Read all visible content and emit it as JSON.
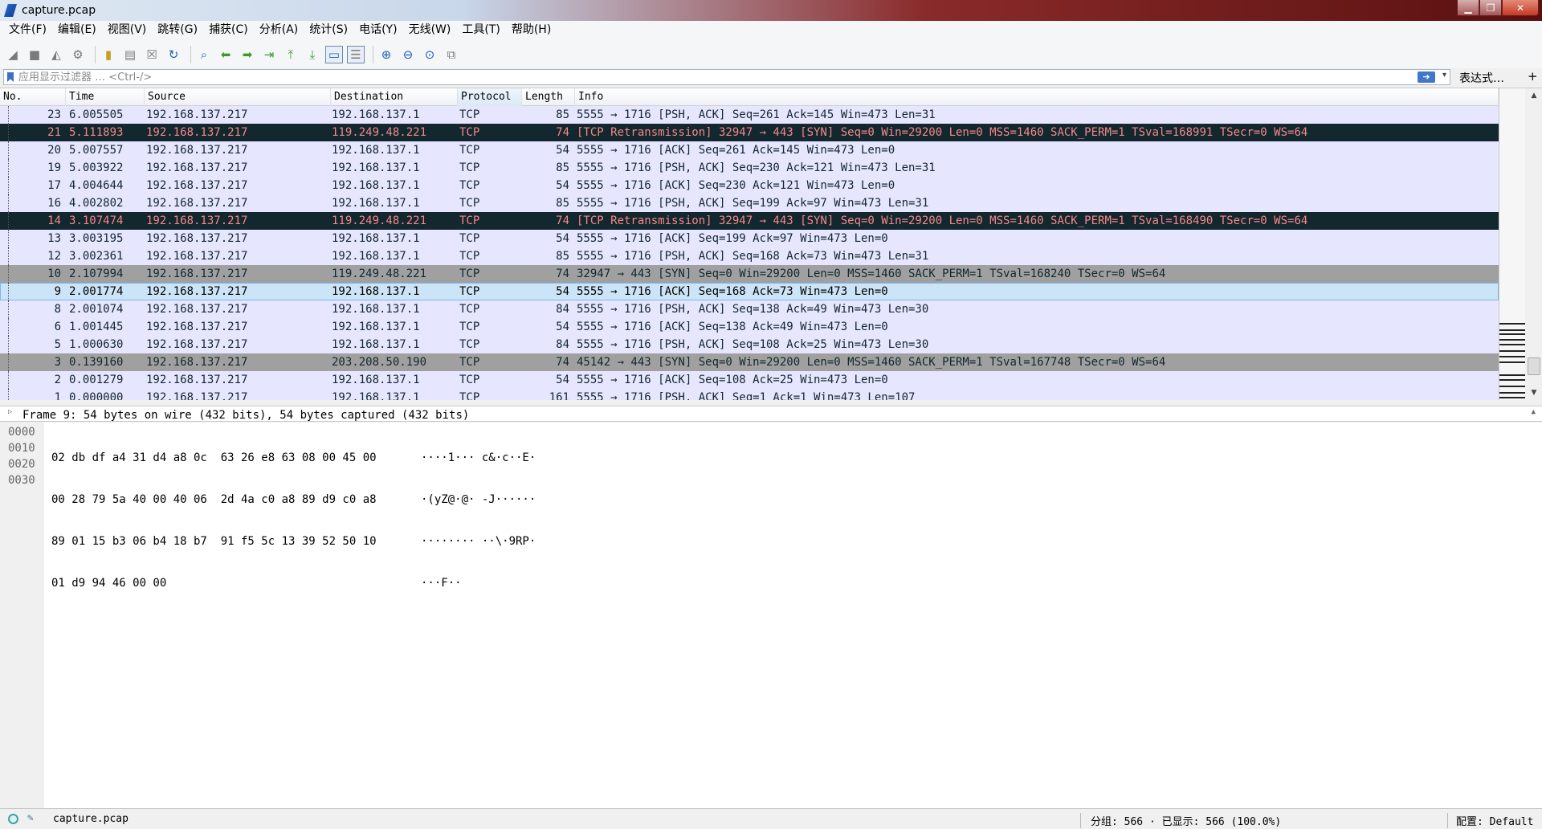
{
  "window": {
    "title": "capture.pcap",
    "minimize": "▁",
    "maximize": "❐",
    "close": "✕"
  },
  "menu": [
    "文件(F)",
    "编辑(E)",
    "视图(V)",
    "跳转(G)",
    "捕获(C)",
    "分析(A)",
    "统计(S)",
    "电话(Y)",
    "无线(W)",
    "工具(T)",
    "帮助(H)"
  ],
  "toolbar": {
    "icons": [
      "shark-fin-start-icon",
      "stop-square-icon",
      "restart-fin-icon",
      "capture-options-gear-icon",
      "open-folder-icon",
      "save-file-icon",
      "close-file-icon",
      "reload-icon",
      "find-magnifier-icon",
      "go-back-arrow-icon",
      "go-forward-arrow-icon",
      "go-to-packet-icon",
      "go-first-icon",
      "go-last-icon",
      "auto-scroll-icon",
      "colorize-icon",
      "zoom-in-icon",
      "zoom-out-icon",
      "zoom-normal-icon",
      "resize-columns-icon"
    ]
  },
  "filter": {
    "placeholder": "应用显示过滤器 … <Ctrl-/>",
    "value": "",
    "expression_label": "表达式…",
    "plus_label": "+"
  },
  "packet_list": {
    "columns": [
      "No.",
      "Time",
      "Source",
      "Destination",
      "Protocol",
      "Length",
      "Info"
    ],
    "rows": [
      {
        "no": "23",
        "time": "6.005505",
        "src": "192.168.137.217",
        "dst": "192.168.137.1",
        "proto": "TCP",
        "len": "85",
        "info": "5555 → 1716 [PSH, ACK] Seq=261 Ack=145 Win=473 Len=31",
        "style": "tcp"
      },
      {
        "no": "21",
        "time": "5.111893",
        "src": "192.168.137.217",
        "dst": "119.249.48.221",
        "proto": "TCP",
        "len": "74",
        "info": "[TCP Retransmission] 32947 → 443 [SYN] Seq=0 Win=29200 Len=0 MSS=1460 SACK_PERM=1 TSval=168991 TSecr=0 WS=64",
        "style": "bad"
      },
      {
        "no": "20",
        "time": "5.007557",
        "src": "192.168.137.217",
        "dst": "192.168.137.1",
        "proto": "TCP",
        "len": "54",
        "info": "5555 → 1716 [ACK] Seq=261 Ack=145 Win=473 Len=0",
        "style": "tcp"
      },
      {
        "no": "19",
        "time": "5.003922",
        "src": "192.168.137.217",
        "dst": "192.168.137.1",
        "proto": "TCP",
        "len": "85",
        "info": "5555 → 1716 [PSH, ACK] Seq=230 Ack=121 Win=473 Len=31",
        "style": "tcp"
      },
      {
        "no": "17",
        "time": "4.004644",
        "src": "192.168.137.217",
        "dst": "192.168.137.1",
        "proto": "TCP",
        "len": "54",
        "info": "5555 → 1716 [ACK] Seq=230 Ack=121 Win=473 Len=0",
        "style": "tcp"
      },
      {
        "no": "16",
        "time": "4.002802",
        "src": "192.168.137.217",
        "dst": "192.168.137.1",
        "proto": "TCP",
        "len": "85",
        "info": "5555 → 1716 [PSH, ACK] Seq=199 Ack=97 Win=473 Len=31",
        "style": "tcp"
      },
      {
        "no": "14",
        "time": "3.107474",
        "src": "192.168.137.217",
        "dst": "119.249.48.221",
        "proto": "TCP",
        "len": "74",
        "info": "[TCP Retransmission] 32947 → 443 [SYN] Seq=0 Win=29200 Len=0 MSS=1460 SACK_PERM=1 TSval=168490 TSecr=0 WS=64",
        "style": "bad"
      },
      {
        "no": "13",
        "time": "3.003195",
        "src": "192.168.137.217",
        "dst": "192.168.137.1",
        "proto": "TCP",
        "len": "54",
        "info": "5555 → 1716 [ACK] Seq=199 Ack=97 Win=473 Len=0",
        "style": "tcp"
      },
      {
        "no": "12",
        "time": "3.002361",
        "src": "192.168.137.217",
        "dst": "192.168.137.1",
        "proto": "TCP",
        "len": "85",
        "info": "5555 → 1716 [PSH, ACK] Seq=168 Ack=73 Win=473 Len=31",
        "style": "tcp"
      },
      {
        "no": "10",
        "time": "2.107994",
        "src": "192.168.137.217",
        "dst": "119.249.48.221",
        "proto": "TCP",
        "len": "74",
        "info": "32947 → 443 [SYN] Seq=0 Win=29200 Len=0 MSS=1460 SACK_PERM=1 TSval=168240 TSecr=0 WS=64",
        "style": "syn"
      },
      {
        "no": "9",
        "time": "2.001774",
        "src": "192.168.137.217",
        "dst": "192.168.137.1",
        "proto": "TCP",
        "len": "54",
        "info": "5555 → 1716 [ACK] Seq=168 Ack=73 Win=473 Len=0",
        "style": "selected"
      },
      {
        "no": "8",
        "time": "2.001074",
        "src": "192.168.137.217",
        "dst": "192.168.137.1",
        "proto": "TCP",
        "len": "84",
        "info": "5555 → 1716 [PSH, ACK] Seq=138 Ack=49 Win=473 Len=30",
        "style": "tcp"
      },
      {
        "no": "6",
        "time": "1.001445",
        "src": "192.168.137.217",
        "dst": "192.168.137.1",
        "proto": "TCP",
        "len": "54",
        "info": "5555 → 1716 [ACK] Seq=138 Ack=49 Win=473 Len=0",
        "style": "tcp"
      },
      {
        "no": "5",
        "time": "1.000630",
        "src": "192.168.137.217",
        "dst": "192.168.137.1",
        "proto": "TCP",
        "len": "84",
        "info": "5555 → 1716 [PSH, ACK] Seq=108 Ack=25 Win=473 Len=30",
        "style": "tcp"
      },
      {
        "no": "3",
        "time": "0.139160",
        "src": "192.168.137.217",
        "dst": "203.208.50.190",
        "proto": "TCP",
        "len": "74",
        "info": "45142 → 443 [SYN] Seq=0 Win=29200 Len=0 MSS=1460 SACK_PERM=1 TSval=167748 TSecr=0 WS=64",
        "style": "syn"
      },
      {
        "no": "2",
        "time": "0.001279",
        "src": "192.168.137.217",
        "dst": "192.168.137.1",
        "proto": "TCP",
        "len": "54",
        "info": "5555 → 1716 [ACK] Seq=108 Ack=25 Win=473 Len=0",
        "style": "tcp"
      },
      {
        "no": "1",
        "time": "0.000000",
        "src": "192.168.137.217",
        "dst": "192.168.137.1",
        "proto": "TCP",
        "len": "161",
        "info": "5555 → 1716 [PSH, ACK] Seq=1 Ack=1 Win=473 Len=107",
        "style": "tcp"
      }
    ]
  },
  "details": {
    "frame_summary": "Frame 9: 54 bytes on wire (432 bits), 54 bytes captured (432 bits)"
  },
  "bytes": {
    "lines": [
      {
        "offset": "0000",
        "hex": "02 db df a4 31 d4 a8 0c  63 26 e8 63 08 00 45 00",
        "ascii": "····1··· c&·c··E·"
      },
      {
        "offset": "0010",
        "hex": "00 28 79 5a 40 00 40 06  2d 4a c0 a8 89 d9 c0 a8",
        "ascii": "·(yZ@·@· -J······"
      },
      {
        "offset": "0020",
        "hex": "89 01 15 b3 06 b4 18 b7  91 f5 5c 13 39 52 50 10",
        "ascii": "········ ··\\·9RP·"
      },
      {
        "offset": "0030",
        "hex": "01 d9 94 46 00 00",
        "ascii": "···F··"
      }
    ]
  },
  "status": {
    "file": "capture.pcap",
    "counts": "分组: 566 · 已显示: 566 (100.0%)",
    "profile": "配置: Default"
  },
  "colors": {
    "tcp_row_bg": "#e7e6ff",
    "bad_row_bg": "#12272e",
    "bad_row_fg": "#f78787",
    "syn_row_bg": "#a0a0a0",
    "selected_row_bg": "#cce4f7"
  }
}
